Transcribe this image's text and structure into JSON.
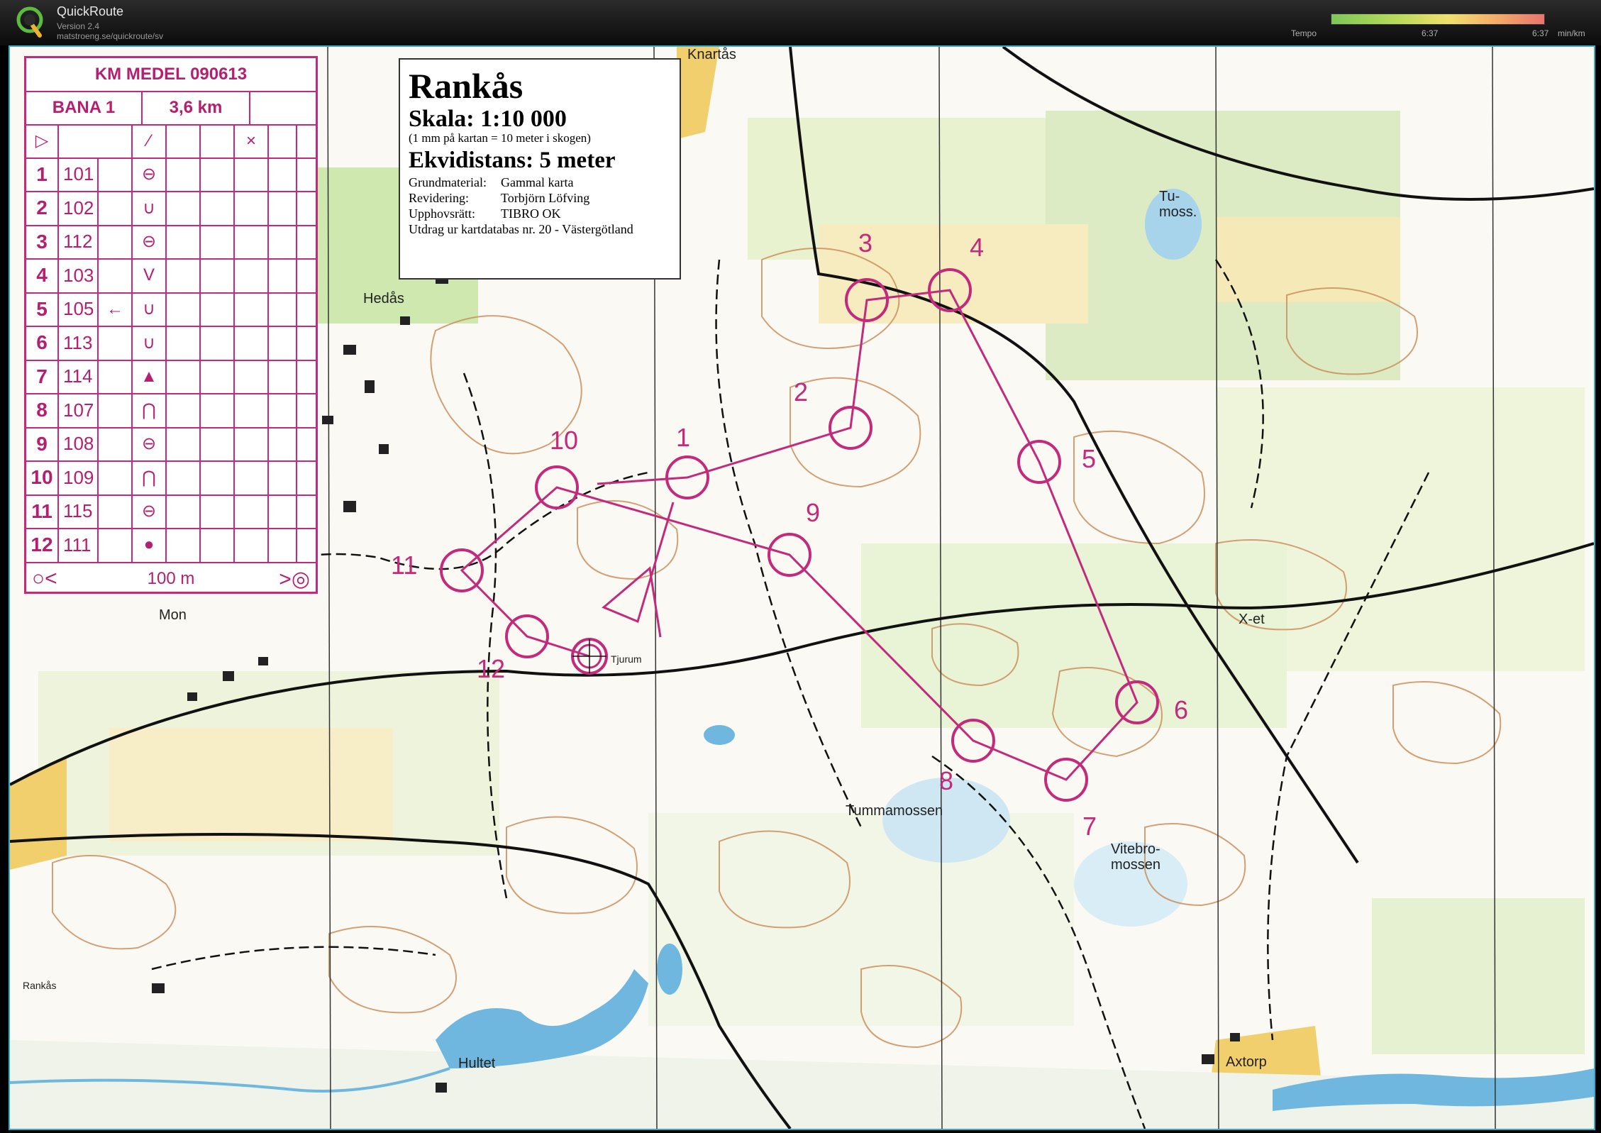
{
  "app": {
    "name": "QuickRoute",
    "version": "Version 2.4",
    "url": "matstroeng.se/quickroute/sv",
    "tempo_label": "Tempo",
    "tempo_min": "6:37",
    "tempo_max": "6:37",
    "tempo_unit": "min/km"
  },
  "map": {
    "title": "Rankås",
    "scale": "Skala:  1:10 000",
    "scale_note": "(1 mm på kartan = 10 meter i skogen)",
    "equidistance": "Ekvidistans:  5 meter",
    "meta": [
      {
        "key": "Grundmaterial:",
        "value": "Gammal karta"
      },
      {
        "key": "Revidering:",
        "value": "Torbjörn Löfving"
      },
      {
        "key": "Upphovsrätt:",
        "value": "TIBRO OK"
      },
      {
        "key": "Utdrag ur kartdatabas nr. 20 - Västergötland",
        "value": ""
      }
    ],
    "place_names": [
      "Knartås",
      "Hedås",
      "Tu-\nmoss.",
      "Mon",
      "Tjurum",
      "X-et",
      "Tummamossen",
      "Vitebro-\nmossen",
      "Rankås",
      "Hultet",
      "Axtorp"
    ]
  },
  "legend": {
    "event": "KM MEDEL 090613",
    "course": "BANA 1",
    "length": "3,6 km",
    "controls": [
      {
        "num": "1",
        "code": "101",
        "dir": "",
        "sym": "⊖"
      },
      {
        "num": "2",
        "code": "102",
        "dir": "",
        "sym": "∪"
      },
      {
        "num": "3",
        "code": "112",
        "dir": "",
        "sym": "⊖"
      },
      {
        "num": "4",
        "code": "103",
        "dir": "",
        "sym": "V"
      },
      {
        "num": "5",
        "code": "105",
        "dir": "←",
        "sym": "∪"
      },
      {
        "num": "6",
        "code": "113",
        "dir": "",
        "sym": "∪"
      },
      {
        "num": "7",
        "code": "114",
        "dir": "",
        "sym": "▲"
      },
      {
        "num": "8",
        "code": "107",
        "dir": "",
        "sym": "⋂"
      },
      {
        "num": "9",
        "code": "108",
        "dir": "",
        "sym": "⊖"
      },
      {
        "num": "10",
        "code": "109",
        "dir": "",
        "sym": "⋂"
      },
      {
        "num": "11",
        "code": "115",
        "dir": "",
        "sym": "⊖"
      },
      {
        "num": "12",
        "code": "111",
        "dir": "",
        "sym": "●"
      }
    ],
    "finish_distance": "100 m"
  },
  "course": {
    "color": "#c42a7b",
    "control_numbers": [
      "1",
      "2",
      "3",
      "4",
      "5",
      "6",
      "7",
      "8",
      "9",
      "10",
      "11",
      "12"
    ]
  }
}
